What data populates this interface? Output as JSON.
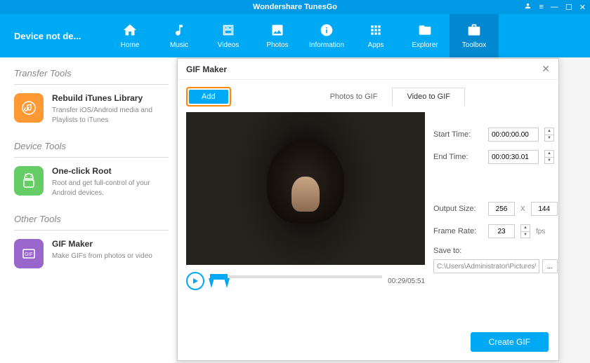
{
  "titlebar": {
    "title": "Wondershare TunesGo"
  },
  "device_status": "Device not de...",
  "nav": [
    {
      "label": "Home",
      "name": "nav-home"
    },
    {
      "label": "Music",
      "name": "nav-music"
    },
    {
      "label": "Videos",
      "name": "nav-videos"
    },
    {
      "label": "Photos",
      "name": "nav-photos"
    },
    {
      "label": "Information",
      "name": "nav-information"
    },
    {
      "label": "Apps",
      "name": "nav-apps"
    },
    {
      "label": "Explorer",
      "name": "nav-explorer"
    },
    {
      "label": "Toolbox",
      "name": "nav-toolbox"
    }
  ],
  "sections": {
    "transfer": {
      "title": "Transfer Tools",
      "item": {
        "title": "Rebuild iTunes Library",
        "desc": "Transfer iOS/Android media and Playlists to iTunes"
      }
    },
    "device": {
      "title": "Device Tools",
      "item": {
        "title": "One-click Root",
        "desc": "Root and get full-control of your Android devices."
      }
    },
    "other": {
      "title": "Other Tools",
      "item": {
        "title": "GIF Maker",
        "desc": "Make GIFs from photos or video"
      }
    }
  },
  "dialog": {
    "title": "GIF Maker",
    "add_label": "Add",
    "tabs": {
      "photos": "Photos to GIF",
      "video": "Video to GIF"
    },
    "start_time_label": "Start Time:",
    "start_time": "00:00:00.00",
    "end_time_label": "End Time:",
    "end_time": "00:00:30.01",
    "output_size_label": "Output Size:",
    "width": "256",
    "height": "144",
    "frame_rate_label": "Frame Rate:",
    "frame_rate": "23",
    "fps": "fps",
    "save_to_label": "Save to:",
    "save_path": "C:\\Users\\Administrator\\Pictures\\W",
    "browse": "...",
    "time_display": "00:29/05:51",
    "create_label": "Create GIF"
  }
}
